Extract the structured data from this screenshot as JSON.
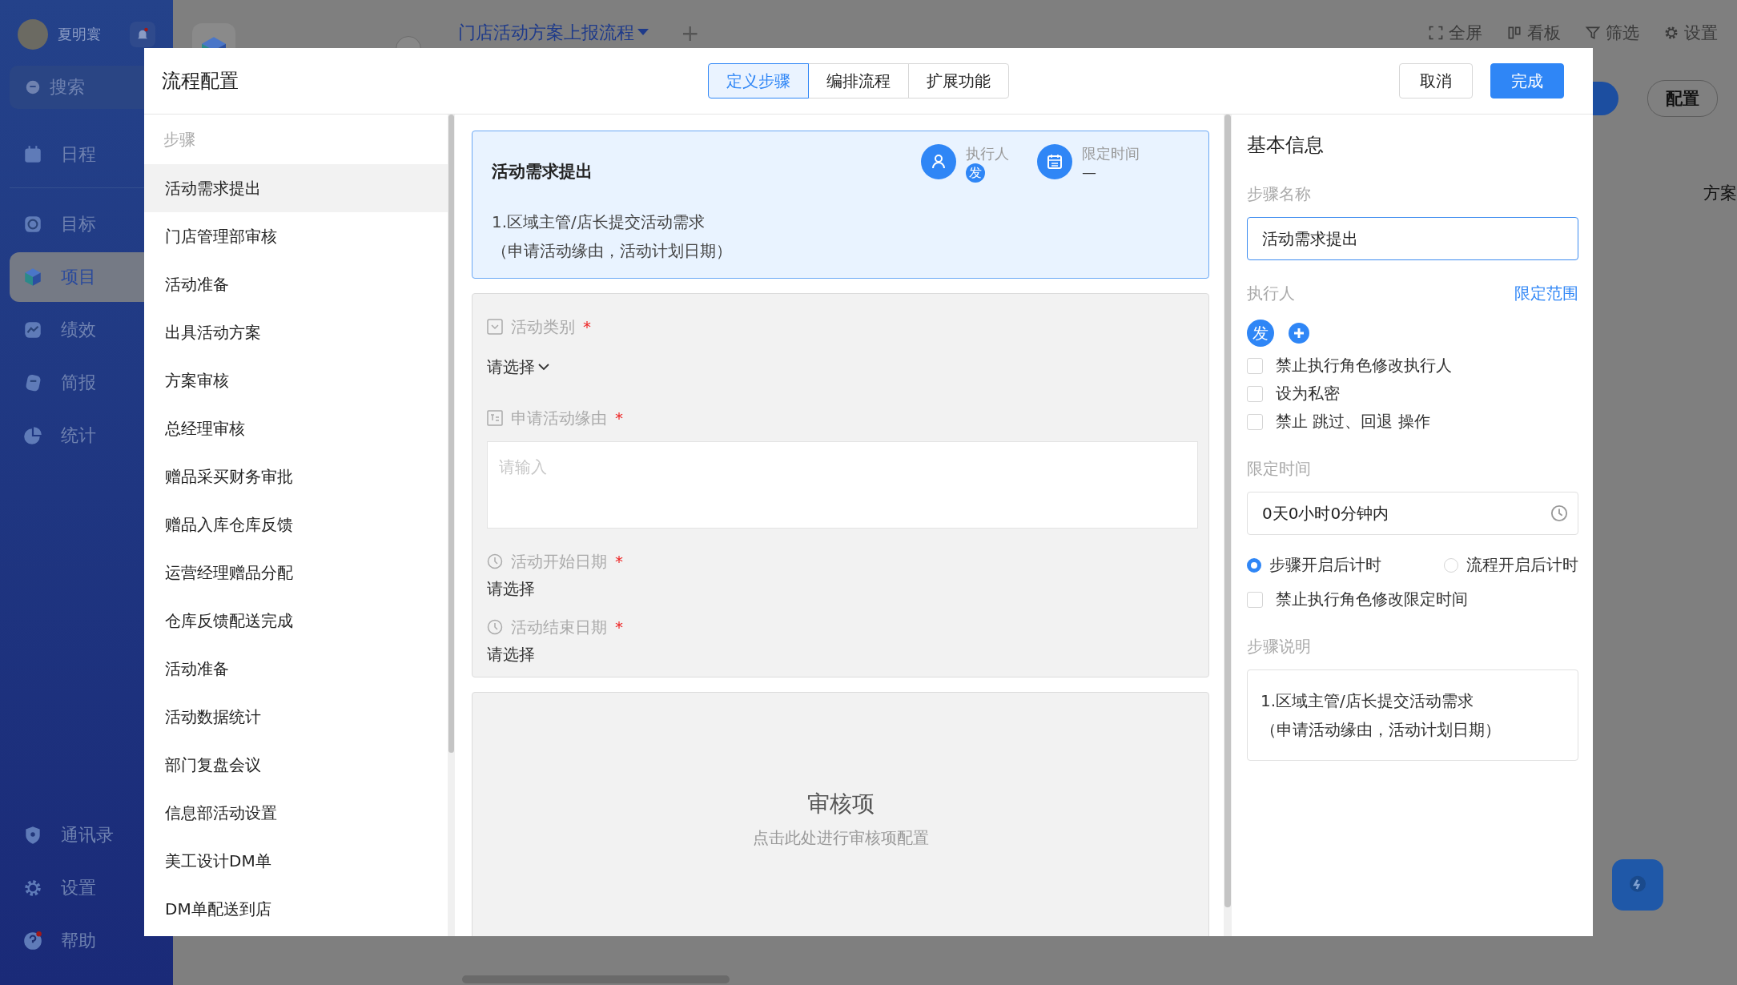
{
  "sidebar": {
    "user": {
      "name": "夏明寰"
    },
    "search": {
      "placeholder": "搜索"
    },
    "nav_top": [
      {
        "label": "日程",
        "selected": false
      },
      {
        "label": "目标",
        "selected": false
      },
      {
        "label": "项目",
        "selected": true
      },
      {
        "label": "绩效",
        "selected": false
      },
      {
        "label": "简报",
        "selected": false
      },
      {
        "label": "统计",
        "selected": false
      }
    ],
    "nav_bottom": [
      {
        "label": "通讯录",
        "selected": false
      },
      {
        "label": "设置",
        "selected": false
      },
      {
        "label": "帮助",
        "selected": false
      }
    ]
  },
  "header": {
    "tab": "门店活动方案上报流程",
    "add": "+",
    "actions": [
      {
        "label": "全屏"
      },
      {
        "label": "看板"
      },
      {
        "label": "筛选"
      },
      {
        "label": "设置"
      }
    ]
  },
  "toolbar": {
    "config_button": "配置",
    "column_1": "方案"
  },
  "modal": {
    "title": "流程配置",
    "segments": [
      {
        "label": "定义步骤",
        "selected": true
      },
      {
        "label": "编排流程",
        "selected": false
      },
      {
        "label": "扩展功能",
        "selected": false
      }
    ],
    "cancel": "取消",
    "done": "完成",
    "steps": {
      "heading": "步骤",
      "items": [
        {
          "label": "活动需求提出",
          "selected": true
        },
        {
          "label": "门店管理部审核",
          "selected": false
        },
        {
          "label": "活动准备",
          "selected": false
        },
        {
          "label": "出具活动方案",
          "selected": false
        },
        {
          "label": "方案审核",
          "selected": false
        },
        {
          "label": "总经理审核",
          "selected": false
        },
        {
          "label": "赠品采买财务审批",
          "selected": false
        },
        {
          "label": "赠品入库仓库反馈",
          "selected": false
        },
        {
          "label": "运营经理赠品分配",
          "selected": false
        },
        {
          "label": "仓库反馈配送完成",
          "selected": false
        },
        {
          "label": "活动准备",
          "selected": false
        },
        {
          "label": "活动数据统计",
          "selected": false
        },
        {
          "label": "部门复盘会议",
          "selected": false
        },
        {
          "label": "信息部活动设置",
          "selected": false
        },
        {
          "label": "美工设计DM单",
          "selected": false
        },
        {
          "label": "DM单配送到店",
          "selected": false
        }
      ]
    },
    "step_card": {
      "title": "活动需求提出",
      "executor_label": "执行人",
      "executor_avatar": "发",
      "time_label": "限定时间",
      "time_value": "—",
      "description": [
        "1.区域主管/店长提交活动需求",
        "（申请活动缘由，活动计划日期）"
      ]
    },
    "form_fields": [
      {
        "kind": "select",
        "label": "活动类别",
        "required_mark": "*",
        "value": "请选择"
      },
      {
        "kind": "textarea",
        "label": "申请活动缘由",
        "required_mark": "*",
        "placeholder": "请输入"
      },
      {
        "kind": "date",
        "label": "活动开始日期",
        "required_mark": "*",
        "value": "请选择"
      },
      {
        "kind": "date",
        "label": "活动结束日期",
        "required_mark": "*",
        "value": "请选择"
      }
    ],
    "review": {
      "title": "审核项",
      "hint": "点击此处进行审核项配置"
    },
    "basic_info": {
      "title": "基本信息",
      "name_label": "步骤名称",
      "name_value": "活动需求提出",
      "executor_label": "执行人",
      "scope_link": "限定范围",
      "executor_avatar": "发",
      "executor_options": [
        {
          "label": "禁止执行角色修改执行人",
          "checked": false
        },
        {
          "label": "设为私密",
          "checked": false
        },
        {
          "label": "禁止 跳过、回退 操作",
          "checked": false
        }
      ],
      "time_label": "限定时间",
      "time_value": "0天0小时0分钟内",
      "timer_modes": [
        {
          "label": "步骤开启后计时",
          "selected": true
        },
        {
          "label": "流程开启后计时",
          "selected": false
        }
      ],
      "time_lock": {
        "label": "禁止执行角色修改限定时间",
        "checked": false
      },
      "desc_label": "步骤说明",
      "description": [
        "1.区域主管/店长提交活动需求",
        "（申请活动缘由，活动计划日期）"
      ]
    }
  }
}
